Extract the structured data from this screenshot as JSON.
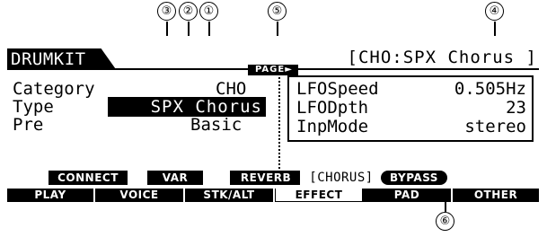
{
  "screen": {
    "title": "DRUMKIT",
    "path": "[CHO:SPX Chorus   ]",
    "page_indicator": "PAGE►"
  },
  "callouts": [
    "①",
    "②",
    "③",
    "④",
    "⑤",
    "⑥"
  ],
  "left_panel": {
    "category_label": "Category",
    "category_value": "CHO",
    "type_label": "Type",
    "type_value": "SPX Chorus",
    "pre_label": "Pre",
    "pre_value": "Basic"
  },
  "right_panel": {
    "rows": [
      {
        "label": "LFOSpeed",
        "value": "0.505Hz"
      },
      {
        "label": "LFODpth",
        "value": "23"
      },
      {
        "label": "InpMode",
        "value": "stereo"
      }
    ]
  },
  "sub_tabs": [
    {
      "label": "CONNECT"
    },
    {
      "label": "VAR"
    },
    {
      "label": "REVERB"
    },
    {
      "label": "[CHORUS]",
      "selected": true
    },
    {
      "label": "BYPASS"
    }
  ],
  "main_tabs": [
    {
      "label": "PLAY"
    },
    {
      "label": "VOICE"
    },
    {
      "label": "STK/ALT"
    },
    {
      "label": "EFFECT",
      "selected": true
    },
    {
      "label": "PAD"
    },
    {
      "label": "OTHER"
    }
  ]
}
